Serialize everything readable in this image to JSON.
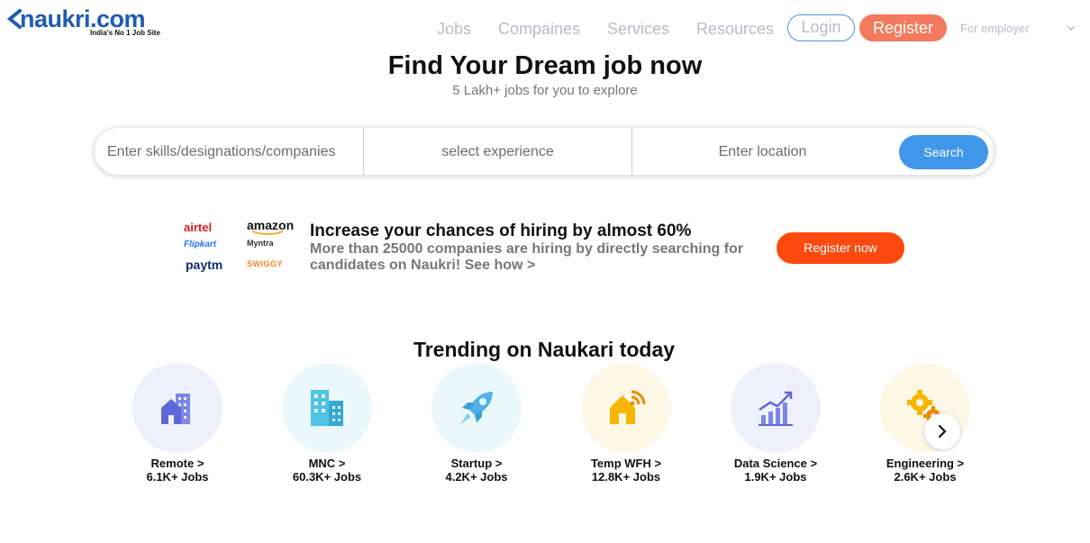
{
  "header": {
    "logo_text": "naukri.com",
    "logo_tagline": "India's No 1 Job Site",
    "nav": {
      "jobs": "Jobs",
      "companies": "Compaines",
      "services": "Services",
      "resources": "Resources"
    },
    "login_label": "Login",
    "register_label": "Register",
    "employer_label": "For employer"
  },
  "hero": {
    "title": "Find Your Dream job now",
    "subtitle": "5 Lakh+ jobs for you to explore"
  },
  "search": {
    "skills_placeholder": "Enter skills/designations/companies",
    "experience_placeholder": "select experience",
    "location_placeholder": "Enter location",
    "button_label": "Search"
  },
  "promo": {
    "brands": {
      "airtel": "airtel",
      "amazon": "amazon",
      "flipkart": "Flipkart",
      "myntra": "Myntra",
      "paytm": "paytm",
      "swiggy": "SWIGGY"
    },
    "title": "Increase your chances of hiring by almost 60%",
    "description": "More than 25000 companies are hiring by directly searching for candidates on Naukri! See how >",
    "button_label": "Register now"
  },
  "trending": {
    "title": "Trending on Naukari today",
    "items": [
      {
        "label": "Remote >",
        "count": "6.1K+ Jobs",
        "icon": "home-building-icon",
        "bg": "#eef1fb"
      },
      {
        "label": "MNC >",
        "count": "60.3K+ Jobs",
        "icon": "office-buildings-icon",
        "bg": "#eaf7fb"
      },
      {
        "label": "Startup >",
        "count": "4.2K+ Jobs",
        "icon": "rocket-icon",
        "bg": "#eaf7fb"
      },
      {
        "label": "Temp WFH >",
        "count": "12.8K+ Jobs",
        "icon": "home-wifi-icon",
        "bg": "#fdf8e6"
      },
      {
        "label": "Data Science >",
        "count": "1.9K+ Jobs",
        "icon": "growth-chart-icon",
        "bg": "#eef1fb"
      },
      {
        "label": "Engineering >",
        "count": "2.6K+ Jobs",
        "icon": "gears-icon",
        "bg": "#fdf8e6"
      }
    ]
  },
  "colors": {
    "brand_blue": "#1e5bb5",
    "register_orange": "#f37a5c",
    "search_blue": "#4096e8",
    "cta_orange": "#fc4a0f"
  }
}
